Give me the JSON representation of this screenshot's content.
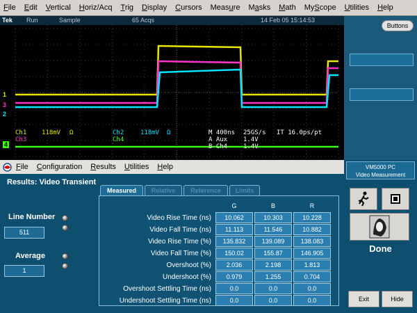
{
  "menubar": {
    "items": [
      {
        "pre": "",
        "u": "F",
        "post": "ile"
      },
      {
        "pre": "",
        "u": "E",
        "post": "dit"
      },
      {
        "pre": "",
        "u": "V",
        "post": "ertical"
      },
      {
        "pre": "",
        "u": "H",
        "post": "oriz/Acq"
      },
      {
        "pre": "",
        "u": "T",
        "post": "rig"
      },
      {
        "pre": "",
        "u": "D",
        "post": "isplay"
      },
      {
        "pre": "",
        "u": "C",
        "post": "ursors"
      },
      {
        "pre": "Meas",
        "u": "u",
        "post": "re"
      },
      {
        "pre": "M",
        "u": "a",
        "post": "sks"
      },
      {
        "pre": "",
        "u": "M",
        "post": "ath"
      },
      {
        "pre": "My",
        "u": "S",
        "post": "cope"
      },
      {
        "pre": "",
        "u": "U",
        "post": "tilities"
      },
      {
        "pre": "",
        "u": "H",
        "post": "elp"
      }
    ]
  },
  "scope": {
    "status": {
      "brand": "Tek",
      "state": "Run",
      "mode": "Sample",
      "acqs": "65 Acqs",
      "datetime": "14 Feb 05 15:14:53"
    },
    "ch_markers": [
      "1",
      "3",
      "2",
      "4"
    ],
    "readouts": {
      "ch1_label": "Ch1",
      "ch1_scale": "118mV",
      "ch1_ohm": "Ω",
      "ch2_label": "Ch2",
      "ch2_scale": "118mV",
      "ch2_ohm": "Ω",
      "ch3_label": "Ch3",
      "ch4_label": "Ch4",
      "timebase": "M 400ns",
      "rate": "25GS/s",
      "it": "IT 16.0ps/pt",
      "trigA": "A Aux",
      "trigA_lvl": "1.4V",
      "trigB": "B Ch4",
      "trigB_lvl": "1.4V"
    },
    "trace_colors": {
      "ch1": "#e6e600",
      "ch2": "#00e5ff",
      "ch3": "#ff33cc",
      "ch4": "#39ff14"
    },
    "side_button": "Buttons"
  },
  "app": {
    "menu": [
      {
        "u": "F",
        "post": "ile"
      },
      {
        "u": "C",
        "post": "onfiguration"
      },
      {
        "u": "R",
        "post": "esults"
      },
      {
        "u": "U",
        "post": "tilities"
      },
      {
        "u": "H",
        "post": "elp"
      }
    ],
    "results_title": "Results: Video Transient",
    "line_number_label": "Line Number",
    "line_number_value": "511",
    "average_label": "Average",
    "average_value": "1",
    "tabs": [
      "Measured",
      "Relative",
      "Reference",
      "Limits"
    ],
    "columns": [
      "G",
      "B",
      "R"
    ],
    "rows": [
      {
        "label": "Video Rise Time (ns)",
        "values": [
          "10.062",
          "10.303",
          "10.228"
        ]
      },
      {
        "label": "Video Fall Time (ns)",
        "values": [
          "11.113",
          "11.546",
          "10.882"
        ]
      },
      {
        "label": "Video Rise Time (%)",
        "values": [
          "135.832",
          "139.089",
          "138.083"
        ]
      },
      {
        "label": "Video Fall Time (%)",
        "values": [
          "150.02",
          "155.87",
          "146.905"
        ]
      },
      {
        "label": "Overshoot (%)",
        "values": [
          "2.036",
          "2.198",
          "1.813"
        ]
      },
      {
        "label": "Undershoot (%)",
        "values": [
          "0.979",
          "1.255",
          "0.704"
        ]
      },
      {
        "label": "Overshoot Settling Time (ns)",
        "values": [
          "0.0",
          "0.0",
          "0.0"
        ]
      },
      {
        "label": "Undershoot Settling Time (ns)",
        "values": [
          "0.0",
          "0.0",
          "0.0"
        ]
      }
    ]
  },
  "right_panel": {
    "title_line1": "VM5000 PC",
    "title_line2": "Video Measurement",
    "status": "Done",
    "exit_label": "Exit",
    "hide_label": "Hide"
  }
}
